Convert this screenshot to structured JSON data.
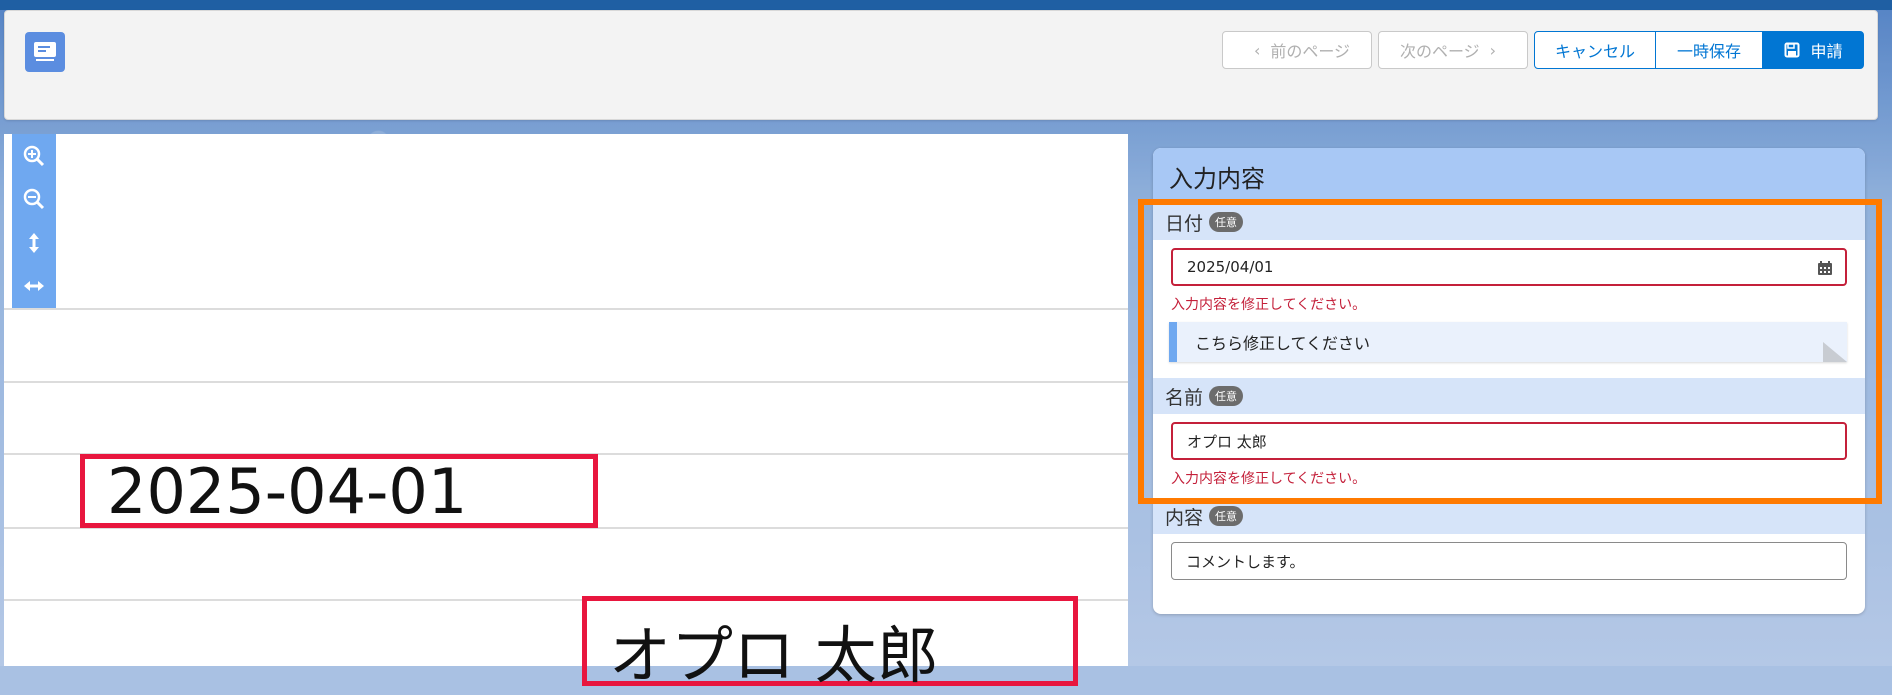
{
  "header": {
    "prev_label": "前のページ",
    "next_label": "次のページ",
    "cancel_label": "キャンセル",
    "save_label": "一時保存",
    "submit_label": "申請"
  },
  "document": {
    "date_text": "2025-04-01",
    "name_text": "オプロ 太郎"
  },
  "panel": {
    "title": "入力内容",
    "fields": [
      {
        "label": "日付",
        "badge": "任意",
        "value": "2025/04/01",
        "error": "入力内容を修正してください。",
        "comment": "こちら修正してください"
      },
      {
        "label": "名前",
        "badge": "任意",
        "value": "オプロ 太郎",
        "error": "入力内容を修正してください。"
      },
      {
        "label": "内容",
        "badge": "任意",
        "value": "コメントします。"
      }
    ]
  },
  "colors": {
    "accent": "#0176d3",
    "error": "#c4203a",
    "highlight": "#ff7a00",
    "doc_box": "#e8163e"
  }
}
